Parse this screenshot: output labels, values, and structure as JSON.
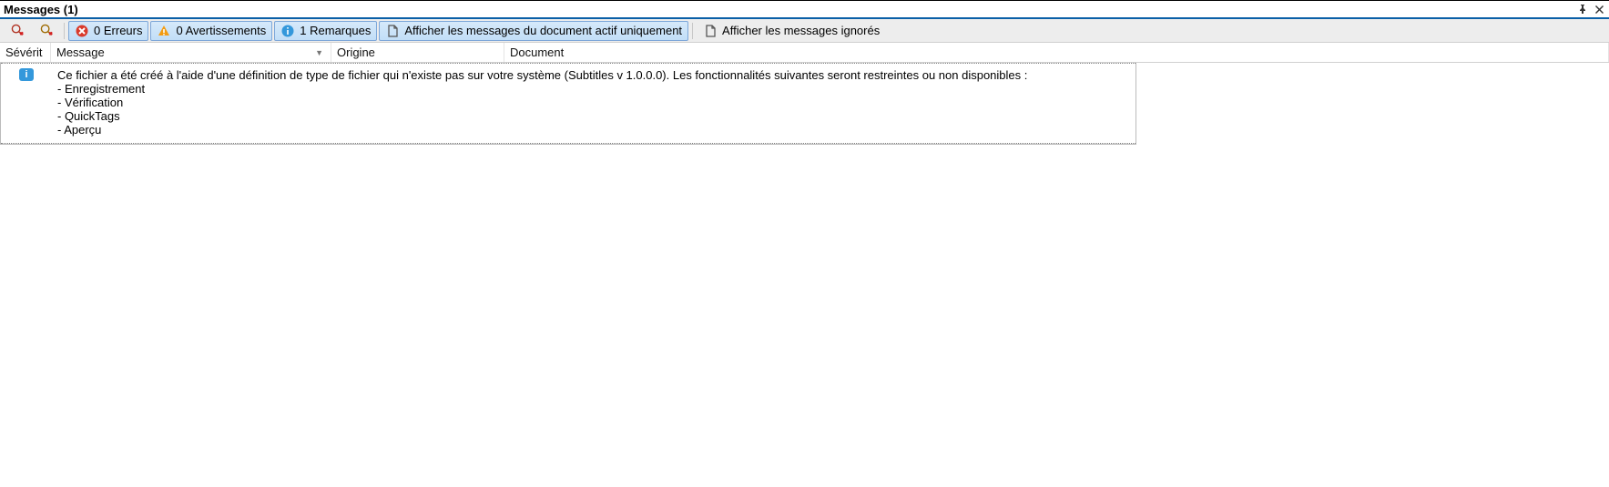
{
  "panel": {
    "title": "Messages (1)"
  },
  "toolbar": {
    "errors": {
      "count": 0,
      "label": "Erreurs"
    },
    "warnings": {
      "count": 0,
      "label": "Avertissements"
    },
    "remarks": {
      "count": 1,
      "label": "Remarques"
    },
    "active_doc_only": "Afficher les messages du document actif uniquement",
    "show_ignored": "Afficher les messages ignorés"
  },
  "columns": {
    "severity": "Sévérit",
    "message": "Message",
    "origin": "Origine",
    "document": "Document"
  },
  "rows": [
    {
      "severity": "info",
      "message": "Ce fichier a été créé à l'aide d'une définition de type de fichier qui n'existe pas sur votre système (Subtitles v 1.0.0.0). Les fonctionnalités suivantes seront restreintes ou non disponibles :\n- Enregistrement\n- Vérification\n- QuickTags\n- Aperçu",
      "origin": "",
      "document": ""
    }
  ]
}
